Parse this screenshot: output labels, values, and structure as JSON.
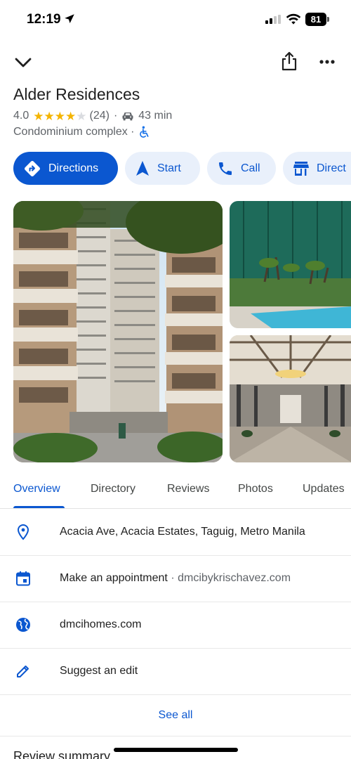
{
  "status": {
    "time": "12:19",
    "battery": "81"
  },
  "header": {
    "back_icon": "chevron-down-icon",
    "share_icon": "share-icon",
    "more_icon": "more-horizontal-icon"
  },
  "place": {
    "title": "Alder Residences",
    "rating": "4.0",
    "stars_filled": 4,
    "stars_total": 5,
    "reviews_count": "(24)",
    "separator": "·",
    "travel_time": "43 min",
    "category": "Condominium complex ·"
  },
  "actions": [
    {
      "label": "Directions",
      "icon": "directions-icon"
    },
    {
      "label": "Start",
      "icon": "navigation-arrow-icon"
    },
    {
      "label": "Call",
      "icon": "phone-icon"
    },
    {
      "label": "Direct",
      "icon": "storefront-icon"
    }
  ],
  "tabs": [
    {
      "label": "Overview",
      "active": true
    },
    {
      "label": "Directory",
      "active": false
    },
    {
      "label": "Reviews",
      "active": false
    },
    {
      "label": "Photos",
      "active": false
    },
    {
      "label": "Updates",
      "active": false
    }
  ],
  "info": {
    "address": "Acacia Ave, Acacia Estates, Taguig, Metro Manila",
    "appointment": "Make an appointment",
    "appointment_sep": " · ",
    "appointment_site": "dmcibykrischavez.com",
    "website": "dmcihomes.com",
    "suggest_edit": "Suggest an edit"
  },
  "see_all": "See all",
  "review_summary": "Review summary",
  "colors": {
    "accent": "#0b57d0",
    "chip_bg": "#e9f0fb",
    "star": "#f4b400",
    "star_empty": "#dadce0"
  }
}
